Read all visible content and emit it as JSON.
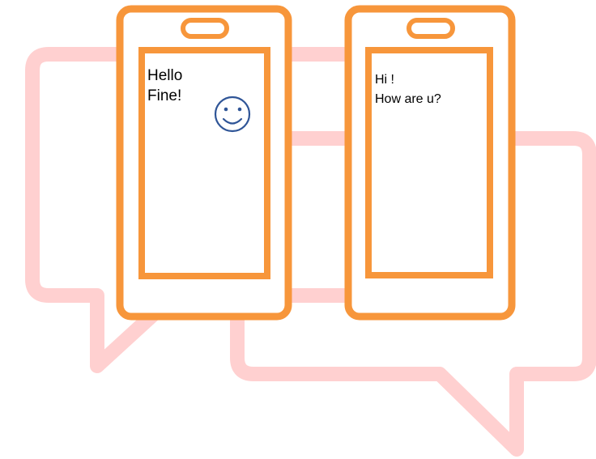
{
  "colors": {
    "phone_outline": "#f7963b",
    "chat_bubble_background": "#ffd0d0",
    "smiley": "#2f5597",
    "text": "#000000",
    "background": "#ffffff"
  },
  "icons": {
    "smiley": "smiley-face-icon",
    "background_bubbles": "chat-bubble-icon"
  },
  "left_phone": {
    "messages": [
      {
        "text": "Hello"
      },
      {
        "text": "Fine!"
      }
    ]
  },
  "right_phone": {
    "messages": [
      {
        "text": "Hi !"
      },
      {
        "text": "How are u?"
      }
    ]
  }
}
